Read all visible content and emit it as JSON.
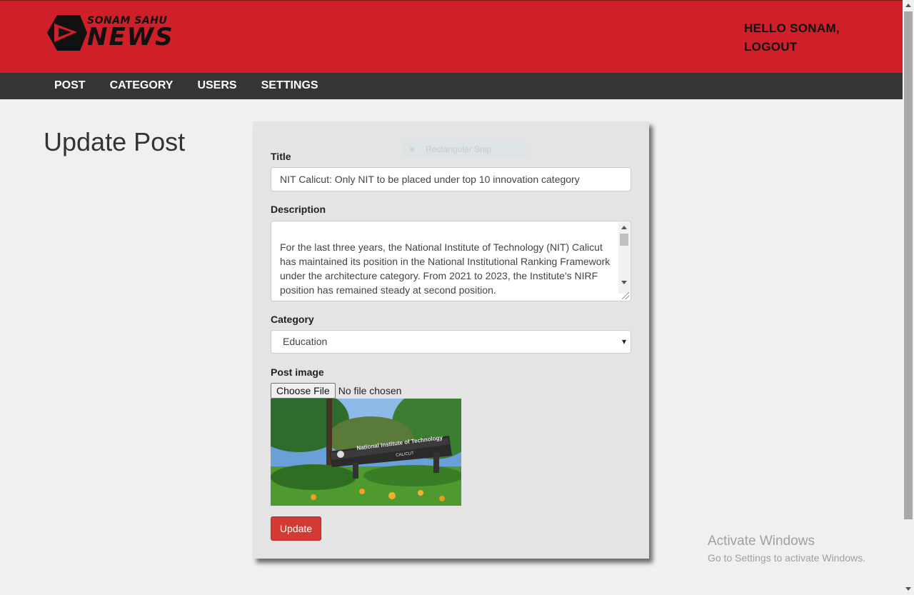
{
  "header": {
    "logo_top_text": "SONAM SAHU",
    "logo_main_text": "NEWS",
    "greeting": "HELLO SONAM,",
    "logout_label": "LOGOUT",
    "background_color": "#cf1f28"
  },
  "nav": {
    "items": [
      {
        "label": "POST"
      },
      {
        "label": "CATEGORY"
      },
      {
        "label": "USERS"
      },
      {
        "label": "SETTINGS"
      }
    ]
  },
  "page": {
    "title": "Update Post"
  },
  "overlay": {
    "snip_label": "Rectangular Snip"
  },
  "form": {
    "title_label": "Title",
    "title_value": "NIT Calicut: Only NIT to be placed under top 10 innovation category",
    "description_label": "Description",
    "description_value": "For the last three years, the National Institute of Technology (NIT) Calicut has maintained its position in the National Institutional Ranking Framework under the architecture category. From 2021 to 2023, the Institute's NIRF position has remained steady at second position.",
    "category_label": "Category",
    "category_selected": "Education",
    "image_label": "Post image",
    "file_button_label": "Choose File",
    "file_status": "No file chosen",
    "image_sign_text": "National Institute of Technology",
    "image_sign_subtext": "CALICUT",
    "update_label": "Update",
    "accent_color": "#d33a33"
  },
  "watermark": {
    "line1": "Activate Windows",
    "line2": "Go to Settings to activate Windows."
  }
}
